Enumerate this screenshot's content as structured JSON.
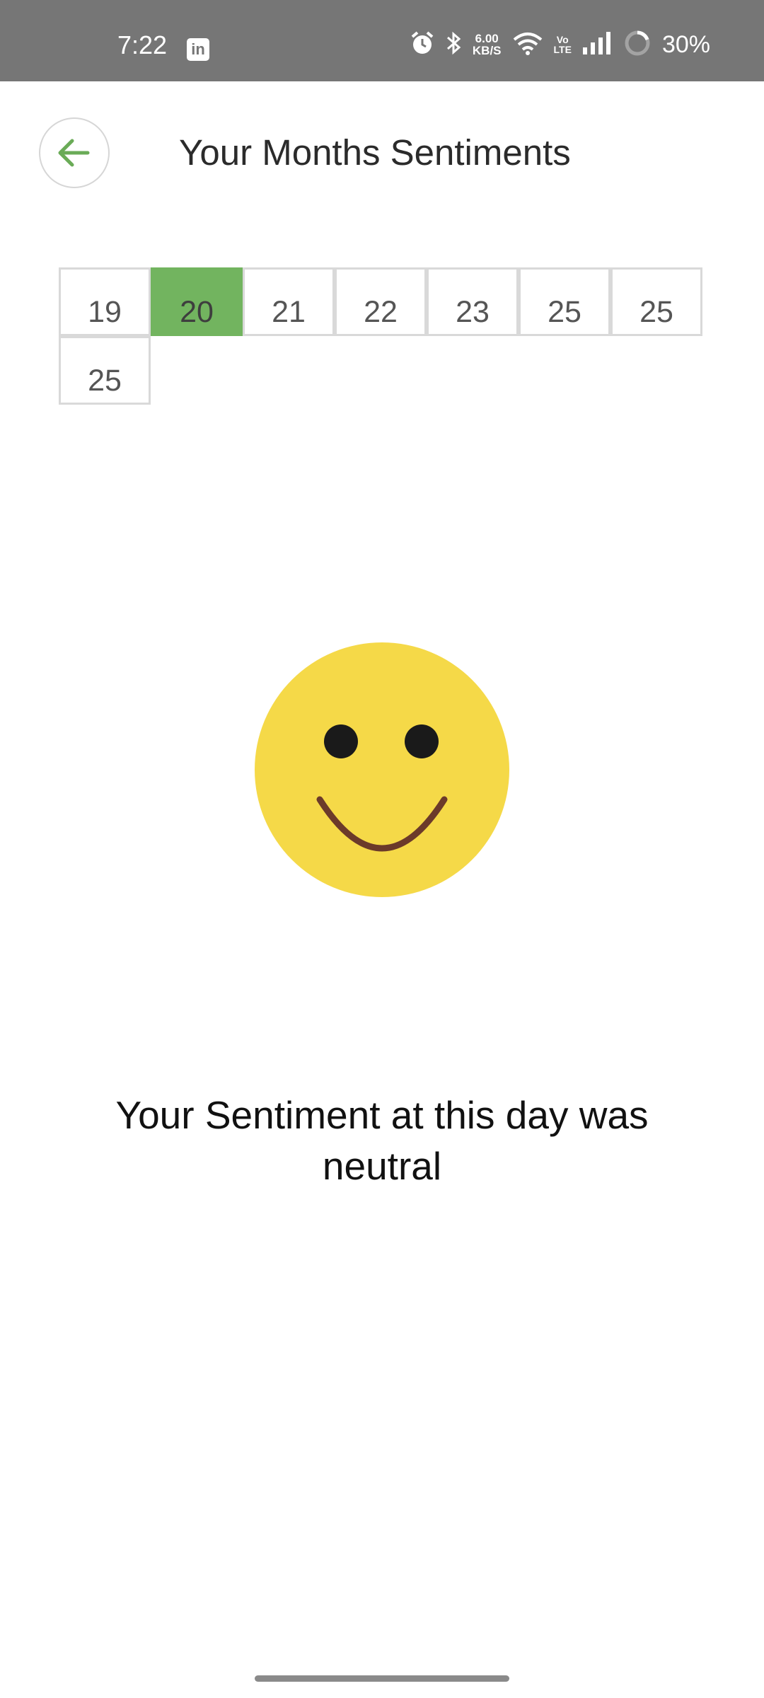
{
  "status_bar": {
    "time": "7:22",
    "app_icon": "linkedin-icon",
    "net_speed_value": "6.00",
    "net_speed_unit": "KB/S",
    "volte_top": "Vo",
    "volte_bottom": "LTE",
    "battery_percent": "30%",
    "background_color": "#767676"
  },
  "header": {
    "back_icon": "arrow-left-icon",
    "title": "Your Months Sentiments"
  },
  "days": {
    "items": [
      {
        "label": "19",
        "selected": false
      },
      {
        "label": "20",
        "selected": true
      },
      {
        "label": "21",
        "selected": false
      },
      {
        "label": "22",
        "selected": false
      },
      {
        "label": "23",
        "selected": false
      },
      {
        "label": "25",
        "selected": false
      },
      {
        "label": "25",
        "selected": false
      },
      {
        "label": "25",
        "selected": false
      }
    ],
    "selected_color": "#72b45f"
  },
  "sentiment": {
    "emoji_icon": "smiley-face-icon",
    "face_color": "#f5d948",
    "message": "Your Sentiment at this day was neutral"
  }
}
